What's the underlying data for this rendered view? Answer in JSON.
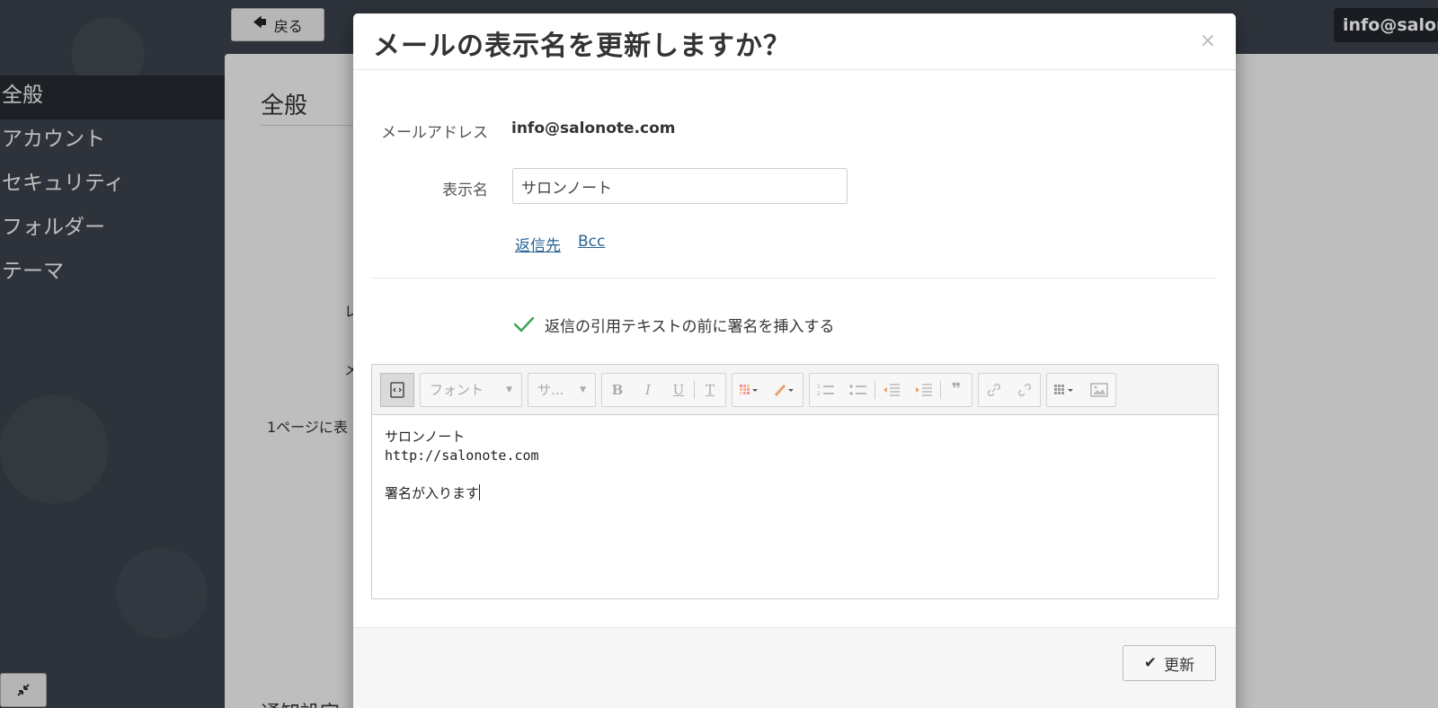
{
  "header": {
    "back_label": "戻る",
    "user_email": "info@salonote.com"
  },
  "sidebar": {
    "items": [
      {
        "label": "全般",
        "active": true
      },
      {
        "label": "アカウント"
      },
      {
        "label": "セキュリティ"
      },
      {
        "label": "フォルダー"
      },
      {
        "label": "テーマ"
      }
    ]
  },
  "main": {
    "title": "全般",
    "ghost_rows": [
      "レ",
      "メ",
      "1ページに表"
    ],
    "bottom_text": "通知設定"
  },
  "modal": {
    "title": "メールの表示名を更新しますか？",
    "close_glyph": "×",
    "email_label": "メールアドレス",
    "email_value": "info@salonote.com",
    "name_label": "表示名",
    "name_value": "サロンノート",
    "links": {
      "reply_to": "返信先",
      "bcc": "Bcc"
    },
    "insert_signature_label": "返信の引用テキストの前に署名を挿入する",
    "insert_signature_checked": true,
    "editor": {
      "toolbar": {
        "font_placeholder": "フォント",
        "size_placeholder": "サ...",
        "bold": "B",
        "italic": "I",
        "underline": "U",
        "clear": "T",
        "quote": "❞"
      },
      "lines": [
        "サロンノート",
        "http://salonote.com",
        "",
        "署名が入ります"
      ]
    },
    "update_label": "更新"
  },
  "colors": {
    "accent_link": "#2a6496",
    "check": "#3aa355"
  }
}
